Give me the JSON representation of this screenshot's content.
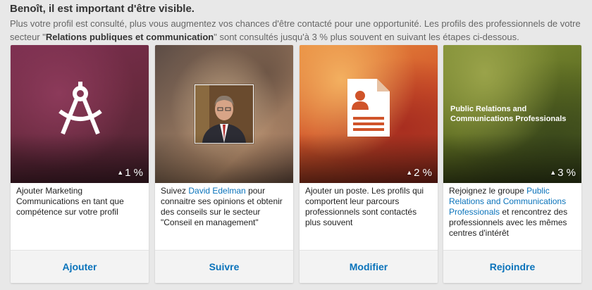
{
  "header": {
    "title": "Benoît, il est important d'être visible.",
    "desc_before": "Plus votre profil est consulté, plus vous augmentez vos chances d'être contacté pour une opportunité. Les profils des professionnels de votre secteur \"",
    "desc_sector": "Relations publiques et communication",
    "desc_after": "\" sont consultés jusqu'à 3 % plus souvent en suivant les étapes ci-dessous."
  },
  "cards": [
    {
      "icon": "compass-icon",
      "percent": "1 %",
      "text": "Ajouter Marketing Communications en tant que compétence sur votre profil",
      "action": "Ajouter"
    },
    {
      "icon": "person-photo",
      "percent": "",
      "text_before": "Suivez ",
      "link": "David Edelman",
      "text_after": " pour connaitre ses opinions et obtenir des conseils sur le secteur \"Conseil en management\"",
      "action": "Suivre"
    },
    {
      "icon": "document-icon",
      "percent": "2 %",
      "text": "Ajouter un poste. Les profils qui comportent leur parcours professionnels sont contactés plus souvent",
      "action": "Modifier"
    },
    {
      "icon": "group-name",
      "group_name": "Public Relations and Communications Professionals",
      "percent": "3 %",
      "text_before": "Rejoignez le groupe ",
      "link": "Public Relations and Communications Professionals",
      "text_after": " et rencontrez des professionnels avec les mêmes centres d'intérêt",
      "action": "Rejoindre"
    }
  ],
  "colors": {
    "link": "#0a73bb",
    "background": "#e8e8e8",
    "action_bg": "#f3f3f3"
  }
}
